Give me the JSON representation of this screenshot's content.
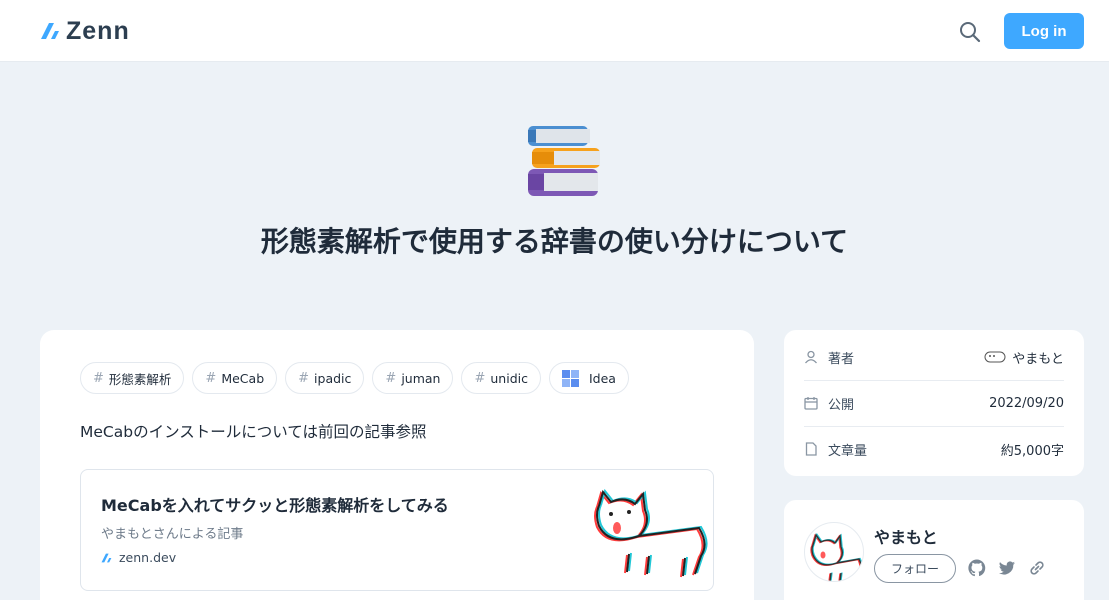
{
  "header": {
    "logo_text": "Zenn",
    "search_icon": "search-icon",
    "login_label": "Log in"
  },
  "article": {
    "emoji": "books-emoji",
    "title": "形態素解析で使用する辞書の使い分けについて",
    "tags": [
      {
        "label": "形態素解析",
        "icon": "hash"
      },
      {
        "label": "MeCab",
        "icon": "hash"
      },
      {
        "label": "ipadic",
        "icon": "hash"
      },
      {
        "label": "juman",
        "icon": "hash"
      },
      {
        "label": "unidic",
        "icon": "hash"
      },
      {
        "label": "Idea",
        "icon": "idea-icon"
      }
    ],
    "intro": "MeCabのインストールについては前回の記事参照",
    "link_card": {
      "title": "MeCabを入れてサクッと形態素解析をしてみる",
      "description": "やまもとさんによる記事",
      "domain": "zenn.dev"
    }
  },
  "sidebar": {
    "meta": [
      {
        "label": "著者",
        "value": "やまもと",
        "icon": "user-icon"
      },
      {
        "label": "公開",
        "value": "2022/09/20",
        "icon": "calendar-icon"
      },
      {
        "label": "文章量",
        "value": "約5,000字",
        "icon": "document-icon"
      }
    ],
    "author": {
      "name": "やまもと",
      "follow_label": "フォロー",
      "social": [
        "github-icon",
        "twitter-icon",
        "link-icon"
      ]
    }
  },
  "colors": {
    "accent": "#3ea8ff",
    "background": "#edf2f7",
    "text": "#1f2b3a"
  }
}
